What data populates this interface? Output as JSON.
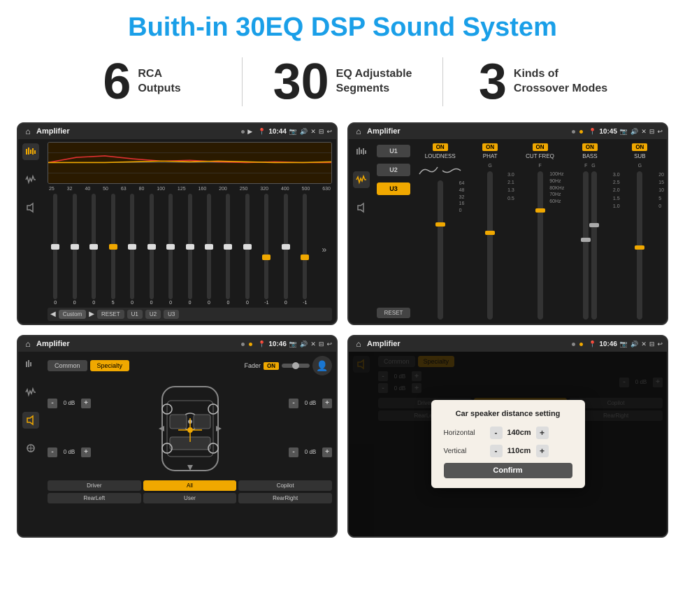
{
  "page": {
    "title": "Buith-in 30EQ DSP Sound System"
  },
  "stats": [
    {
      "number": "6",
      "label_line1": "RCA",
      "label_line2": "Outputs"
    },
    {
      "number": "30",
      "label_line1": "EQ Adjustable",
      "label_line2": "Segments"
    },
    {
      "number": "3",
      "label_line1": "Kinds of",
      "label_line2": "Crossover Modes"
    }
  ],
  "screens": {
    "eq": {
      "app_name": "Amplifier",
      "time": "10:44",
      "freq_labels": [
        "25",
        "32",
        "40",
        "50",
        "63",
        "80",
        "100",
        "125",
        "160",
        "200",
        "250",
        "320",
        "400",
        "500",
        "630"
      ],
      "slider_values": [
        "0",
        "0",
        "0",
        "5",
        "0",
        "0",
        "0",
        "0",
        "0",
        "0",
        "0",
        "-1",
        "0",
        "-1"
      ],
      "preset": "Custom",
      "buttons": [
        "RESET",
        "U1",
        "U2",
        "U3"
      ]
    },
    "amp2": {
      "app_name": "Amplifier",
      "time": "10:45",
      "presets": [
        "U1",
        "U2",
        "U3"
      ],
      "sections": [
        {
          "toggle": "ON",
          "label": "LOUDNESS"
        },
        {
          "toggle": "ON",
          "label": "PHAT"
        },
        {
          "toggle": "ON",
          "label": "CUT FREQ"
        },
        {
          "toggle": "ON",
          "label": "BASS"
        },
        {
          "toggle": "ON",
          "label": "SUB"
        }
      ],
      "reset_label": "RESET"
    },
    "crossover": {
      "app_name": "Amplifier",
      "time": "10:46",
      "tabs": [
        "Common",
        "Specialty"
      ],
      "fader_label": "Fader",
      "fader_toggle": "ON",
      "db_values": [
        "0 dB",
        "0 dB",
        "0 dB",
        "0 dB"
      ],
      "buttons": [
        "Driver",
        "All",
        "Copilot",
        "RearLeft",
        "User",
        "RearRight"
      ]
    },
    "dialog": {
      "app_name": "Amplifier",
      "time": "10:46",
      "tabs": [
        "Common",
        "Specialty"
      ],
      "dialog_title": "Car speaker distance setting",
      "horizontal_label": "Horizontal",
      "horizontal_value": "140cm",
      "vertical_label": "Vertical",
      "vertical_value": "110cm",
      "confirm_label": "Confirm",
      "db_values": [
        "0 dB",
        "0 dB"
      ],
      "buttons": [
        "Driver",
        "Copilot",
        "RearLeft",
        "RearRight"
      ]
    }
  }
}
